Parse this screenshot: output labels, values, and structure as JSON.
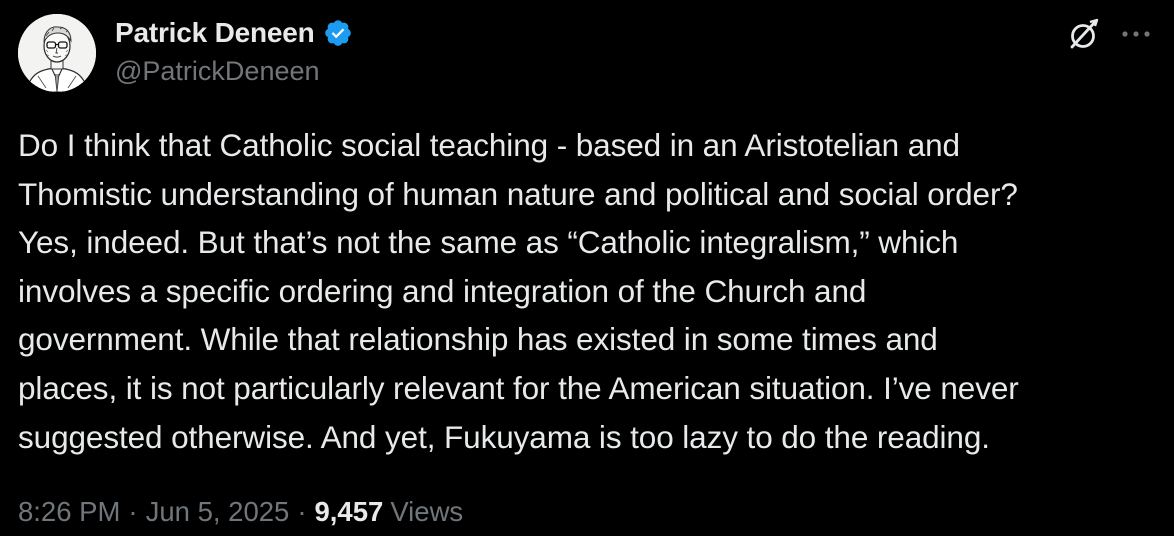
{
  "author": {
    "display_name": "Patrick Deneen",
    "handle": "@PatrickDeneen",
    "verified": true,
    "verified_color": "#1d9bf0"
  },
  "icons": {
    "grok": "grok-icon",
    "more": "more-icon",
    "verified": "verified-badge-icon"
  },
  "tweet": {
    "lines": [
      "Do I think that Catholic social teaching - based in an Aristotelian and",
      "Thomistic understanding of human nature and political and social order?",
      "Yes, indeed. But that’s not the same as “Catholic integralism,” which",
      "involves a specific ordering and integration of the Church and",
      "government. While that relationship has existed in some times and",
      "places, it is not particularly relevant for the American situation. I’ve never",
      "suggested otherwise. And yet, Fukuyama is too lazy to do the reading."
    ]
  },
  "meta": {
    "time": "8:26 PM",
    "separator": "·",
    "date": "Jun 5, 2025",
    "views_count": "9,457",
    "views_label": "Views"
  },
  "colors": {
    "background": "#000000",
    "text_primary": "#e7e9ea",
    "text_secondary": "#71767b"
  }
}
